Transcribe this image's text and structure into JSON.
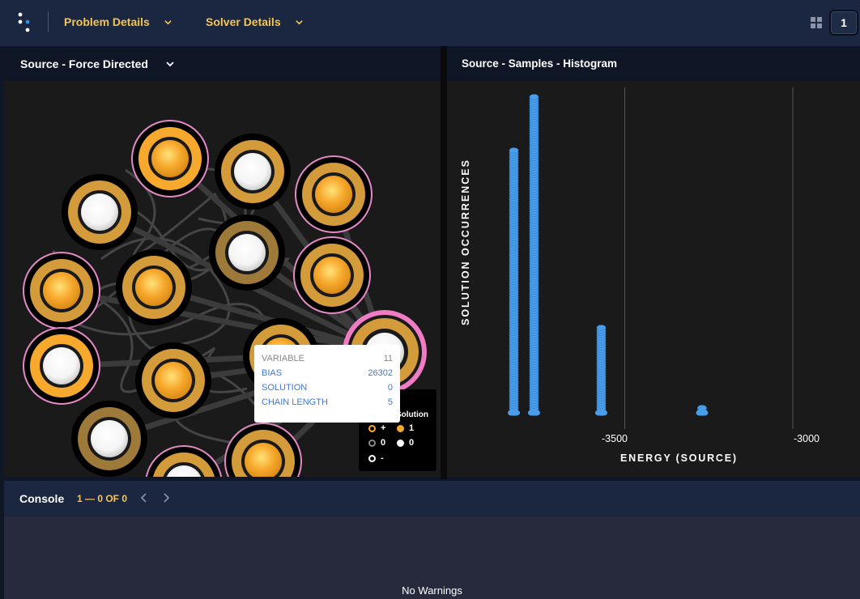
{
  "header": {
    "menus": [
      "Problem Details",
      "Solver Details"
    ],
    "page_number": "1"
  },
  "left_panel": {
    "title": "Source - Force Directed",
    "tooltip": {
      "rows": [
        {
          "key": "VARIABLE",
          "value": "11"
        },
        {
          "key": "BIAS",
          "value": "26302"
        },
        {
          "key": "SOLUTION",
          "value": "0"
        },
        {
          "key": "CHAIN LENGTH",
          "value": "5"
        }
      ]
    },
    "legend": {
      "solution_title": "Solution",
      "bias_plus": "+",
      "bias_zero": "0",
      "bias_minus": "-",
      "solution_one": "1",
      "solution_zero": "0"
    }
  },
  "right_panel": {
    "title": "Source - Samples - Histogram"
  },
  "chart_data": {
    "type": "scatter",
    "title": "",
    "xlabel": "ENERGY (SOURCE)",
    "ylabel": "SOLUTION OCCURRENCES",
    "x_ticks": [
      "-3500",
      "-3000"
    ],
    "xlim": [
      -4000,
      -2800
    ],
    "ylim": [
      0,
      110
    ],
    "grid": "vertical gridlines at x ticks",
    "series": [
      {
        "columns": [
          {
            "x": -3830,
            "max_occurrences": 92
          },
          {
            "x": -3770,
            "max_occurrences": 110
          },
          {
            "x": -3570,
            "max_occurrences": 30
          },
          {
            "x": -3270,
            "max_occurrences": 2
          }
        ]
      }
    ],
    "marker_color": "#4a9de8"
  },
  "console": {
    "title": "Console",
    "count": "1 — 0 OF 0",
    "message": "No Warnings"
  },
  "colors": {
    "accent": "#f5c652",
    "node_orange": "#f7a92e",
    "node_ring_gold": "#d49b3a",
    "node_ring_brown": "#9d7a3a",
    "highlight_pink": "#f07cc4",
    "point_blue": "#4a9de8"
  }
}
